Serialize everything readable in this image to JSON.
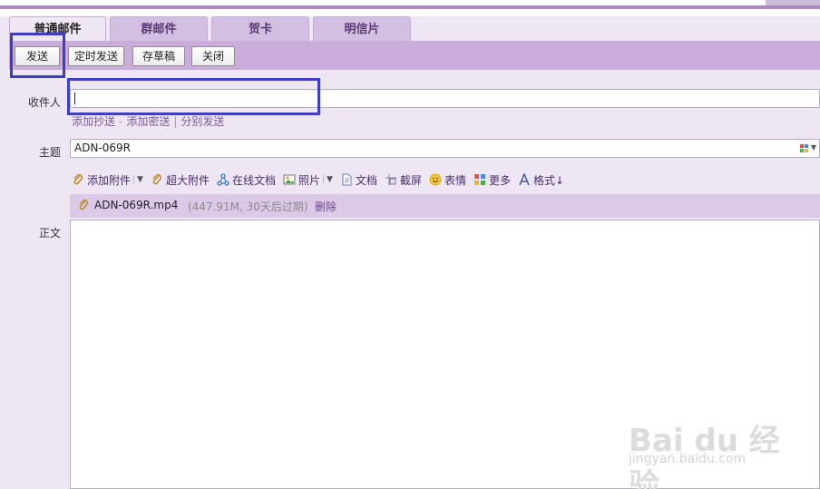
{
  "tabs": [
    {
      "label": "普通邮件",
      "active": true
    },
    {
      "label": "群邮件",
      "active": false
    },
    {
      "label": "贺卡",
      "active": false
    },
    {
      "label": "明信片",
      "active": false
    }
  ],
  "toolbar": {
    "send": "发送",
    "scheduled_send": "定时发送",
    "save_draft": "存草稿",
    "close": "关闭"
  },
  "recipient": {
    "label": "收件人",
    "value": "",
    "links": {
      "add_cc": "添加抄送",
      "dash": "-",
      "add_bcc": "添加密送",
      "bar": "|",
      "separate_send": "分别发送"
    }
  },
  "subject": {
    "label": "主题",
    "value": "ADN-069R"
  },
  "tools": [
    {
      "icon": "paperclip-icon",
      "label": "添加附件",
      "dropdown": true
    },
    {
      "icon": "paperclip-icon",
      "label": "超大附件",
      "dropdown": false
    },
    {
      "icon": "share-icon",
      "label": "在线文档",
      "dropdown": false
    },
    {
      "icon": "picture-icon",
      "label": "照片",
      "dropdown": true
    },
    {
      "icon": "document-icon",
      "label": "文档",
      "dropdown": false
    },
    {
      "icon": "scissors-icon",
      "label": "截屏",
      "dropdown": false
    },
    {
      "icon": "smiley-icon",
      "label": "表情",
      "dropdown": false
    },
    {
      "icon": "grid-icon",
      "label": "更多",
      "dropdown": false
    },
    {
      "icon": "font-icon",
      "label": "格式↓",
      "dropdown": false
    }
  ],
  "attachment": {
    "name": "ADN-069R.mp4",
    "meta": "(447.91M, 30天后过期)",
    "delete": "删除"
  },
  "body": {
    "label": "正文",
    "value": ""
  },
  "watermark": {
    "brand": "Bai du 经验",
    "url": "jingyan.baidu.com"
  },
  "colors": {
    "toolbar_bg": "#c9acd9",
    "page_bg": "#efe6f3",
    "highlight": "#3c3fc0",
    "link": "#7a5a9a"
  }
}
